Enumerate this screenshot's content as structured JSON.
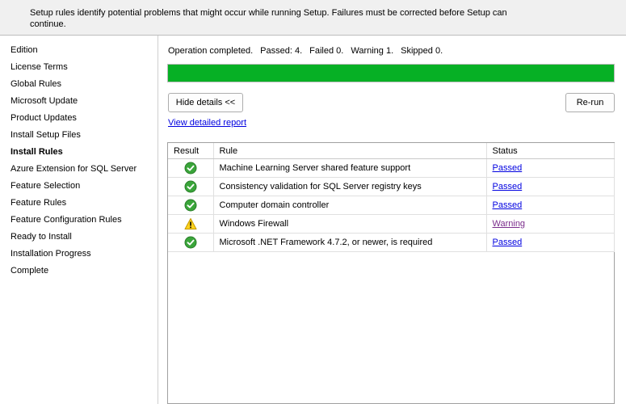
{
  "header": {
    "description": "Setup rules identify potential problems that might occur while running Setup. Failures must be corrected before Setup can continue."
  },
  "sidebar": {
    "items": [
      {
        "label": "Edition",
        "active": false
      },
      {
        "label": "License Terms",
        "active": false
      },
      {
        "label": "Global Rules",
        "active": false
      },
      {
        "label": "Microsoft Update",
        "active": false
      },
      {
        "label": "Product Updates",
        "active": false
      },
      {
        "label": "Install Setup Files",
        "active": false
      },
      {
        "label": "Install Rules",
        "active": true
      },
      {
        "label": "Azure Extension for SQL Server",
        "active": false
      },
      {
        "label": "Feature Selection",
        "active": false
      },
      {
        "label": "Feature Rules",
        "active": false
      },
      {
        "label": "Feature Configuration Rules",
        "active": false
      },
      {
        "label": "Ready to Install",
        "active": false
      },
      {
        "label": "Installation Progress",
        "active": false
      },
      {
        "label": "Complete",
        "active": false
      }
    ]
  },
  "operation": {
    "status_text": "Operation completed.",
    "passed": "Passed: 4.",
    "failed": "Failed 0.",
    "warning": "Warning 1.",
    "skipped": "Skipped 0.",
    "progress": 1.0,
    "progress_color": "#06b025"
  },
  "buttons": {
    "hide_details_label": "Hide details <<",
    "rerun_label": "Re-run"
  },
  "links": {
    "view_report": "View detailed report"
  },
  "grid": {
    "columns": [
      "Result",
      "Rule",
      "Status"
    ],
    "rows": [
      {
        "result_icon": "success-check-icon",
        "rule": "Machine Learning Server shared feature support",
        "status": "Passed"
      },
      {
        "result_icon": "success-check-icon",
        "rule": "Consistency validation for SQL Server registry keys",
        "status": "Passed"
      },
      {
        "result_icon": "success-check-icon",
        "rule": "Computer domain controller",
        "status": "Passed"
      },
      {
        "result_icon": "warning-triangle-icon",
        "rule": "Windows Firewall",
        "status": "Warning"
      },
      {
        "result_icon": "success-check-icon",
        "rule": "Microsoft .NET Framework 4.7.2, or newer, is required",
        "status": "Passed"
      }
    ]
  }
}
